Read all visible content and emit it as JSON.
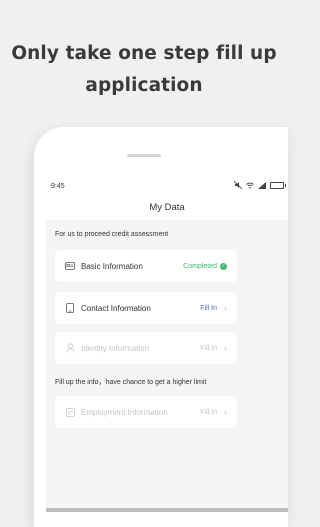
{
  "headline": {
    "line1": "Only take one step fill up",
    "line2": "application"
  },
  "status_bar": {
    "time": "9:45",
    "icons": [
      "mute-icon",
      "wifi-icon",
      "signal-icon",
      "battery-icon"
    ]
  },
  "page": {
    "title": "My Data"
  },
  "intro_note": "For us to proceed credit assessment",
  "cards": [
    {
      "label": "Basic Information",
      "status": "Completed",
      "icon": "id-card-icon",
      "state": "completed"
    },
    {
      "label": "Contact Information",
      "status": "Fill In",
      "icon": "contact-book-icon",
      "state": "active"
    },
    {
      "label": "Identity Information",
      "status": "Fill In",
      "icon": "person-icon",
      "state": "disabled"
    }
  ],
  "higher_limit_note": "Fill up the info，have chance to get a higher limit",
  "extra_cards": [
    {
      "label": "Employment Information",
      "status": "Fill In",
      "icon": "document-icon",
      "state": "disabled"
    }
  ],
  "colors": {
    "completed": "#3eb86e",
    "fill_in": "#4a6bbf",
    "disabled": "#c4c4c4",
    "background": "#f0f0f0"
  }
}
